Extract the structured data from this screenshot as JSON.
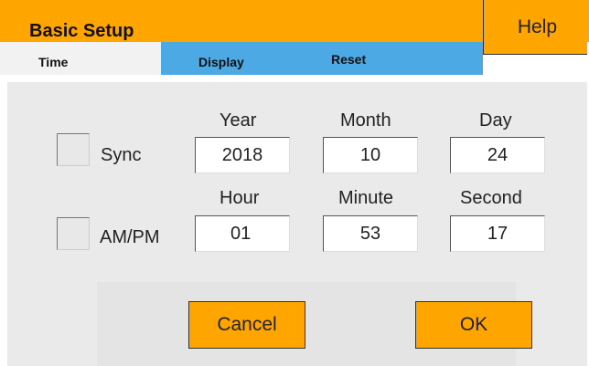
{
  "header": {
    "title": "Basic Setup",
    "help_label": "Help"
  },
  "tabs": [
    {
      "label": "Time",
      "active": true
    },
    {
      "label": "Display",
      "active": false
    },
    {
      "label": "Reset",
      "active": false
    }
  ],
  "date_row": {
    "checkbox_label": "Sync",
    "checked": false,
    "headers": [
      "Year",
      "Month",
      "Day"
    ],
    "values": [
      "2018",
      "10",
      "24"
    ]
  },
  "time_row": {
    "checkbox_label": "AM/PM",
    "checked": false,
    "headers": [
      "Hour",
      "Minute",
      "Second"
    ],
    "values": [
      "01",
      "53",
      "17"
    ]
  },
  "buttons": {
    "cancel_label": "Cancel",
    "ok_label": "OK"
  },
  "colors": {
    "accent": "#FFA500",
    "tab_blue": "#4DA9E4",
    "panel": "#EAEAEA"
  }
}
